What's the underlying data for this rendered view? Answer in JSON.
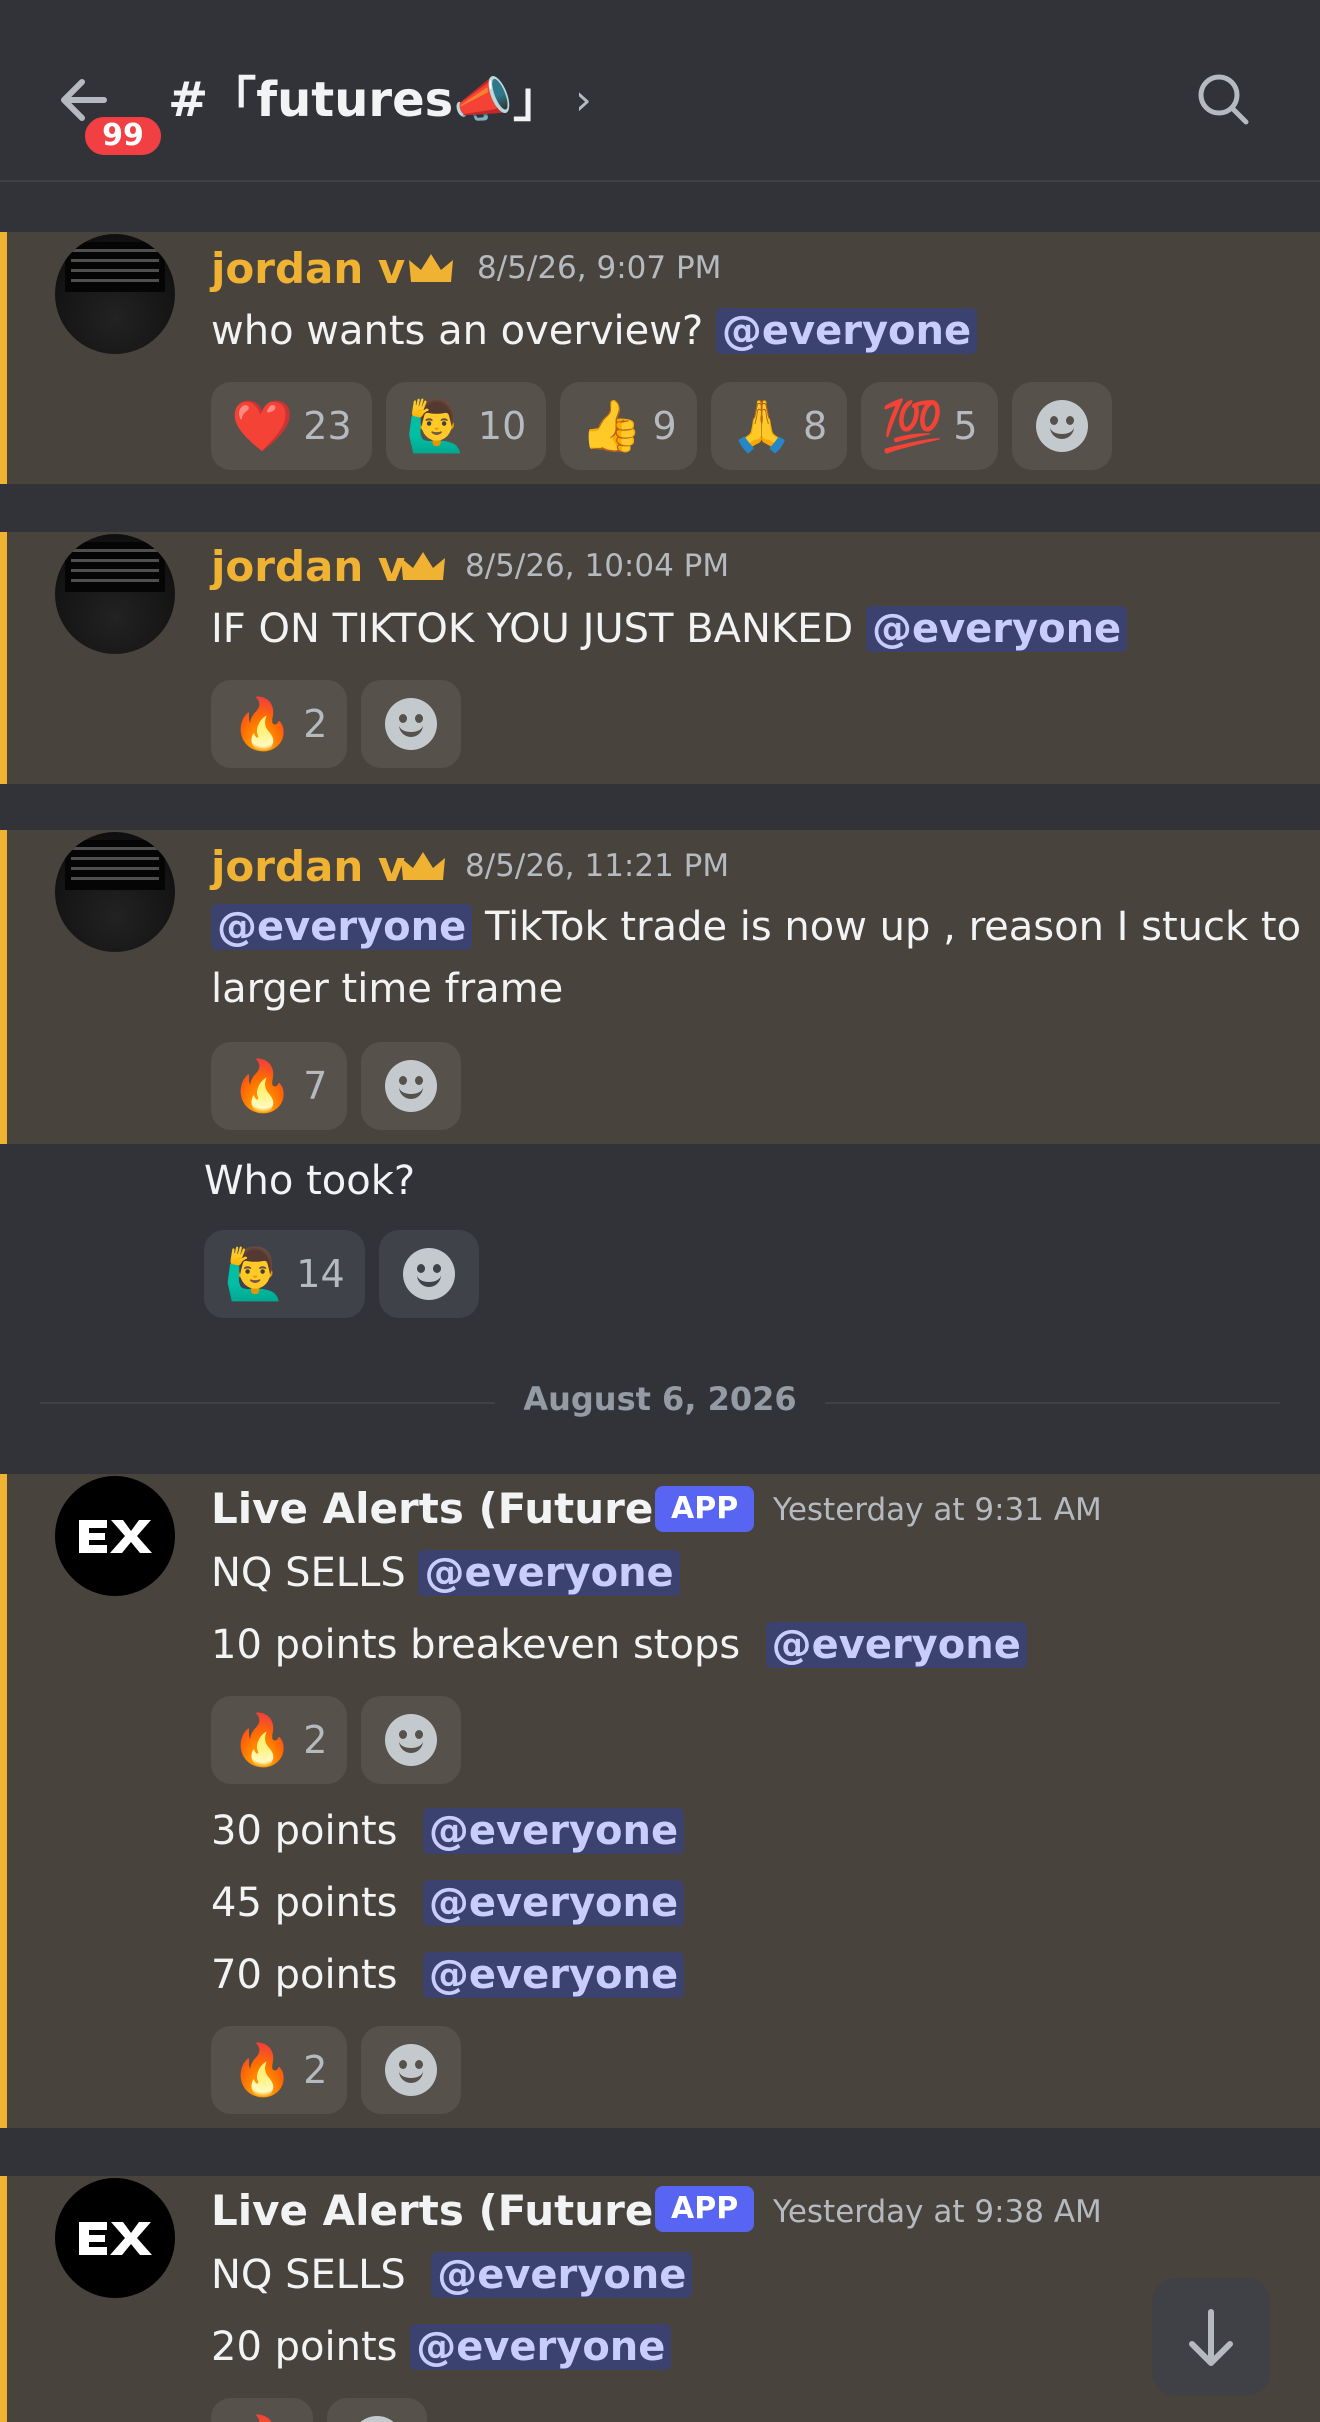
{
  "header": {
    "back_label": "Back",
    "badge_count": "99",
    "channel_title": "#「futures📣」",
    "chevron": "›",
    "search_icon": "search-icon"
  },
  "messages": [
    {
      "author": "jordan v",
      "timestamp": "8/5/26, 9:07 PM",
      "text": "who wants an overview?",
      "mention": "@everyone",
      "reactions": [
        {
          "emoji": "❤️",
          "count": "23"
        },
        {
          "emoji": "🙋‍♂️",
          "count": "10"
        },
        {
          "emoji": "👍",
          "count": "9"
        },
        {
          "emoji": "🙏",
          "count": "8"
        },
        {
          "emoji": "💯",
          "count": "5"
        }
      ]
    },
    {
      "author": "jordan v",
      "timestamp": "8/5/26, 10:04 PM",
      "text": "IF ON TIKTOK YOU JUST BANKED",
      "mention": "@everyone",
      "reactions": [
        {
          "emoji": "🔥",
          "count": "2"
        }
      ]
    },
    {
      "author": "jordan v",
      "timestamp": "8/5/26, 11:21 PM",
      "mention": "@everyone",
      "text_line1": "TikTok trade is now up , reason I stuck to",
      "text_line2": "larger time frame",
      "reactions": [
        {
          "emoji": "🔥",
          "count": "7"
        }
      ]
    },
    {
      "text": "Who took?",
      "reactions": [
        {
          "emoji": "🙋‍♂️",
          "count": "14"
        }
      ]
    },
    {
      "author": "Live Alerts (Futures)",
      "app_badge": "APP",
      "timestamp": "Yesterday at 9:31 AM",
      "line1": "NQ SELLS",
      "line1_mention": "@everyone",
      "line2": "10 points breakeven stops",
      "line2_mention": "@everyone",
      "reactions1": [
        {
          "emoji": "🔥",
          "count": "2"
        }
      ],
      "line3": "30 points",
      "line3_mention": "@everyone",
      "line4": "45 points",
      "line4_mention": "@everyone",
      "line5": "70 points",
      "line5_mention": "@everyone",
      "reactions2": [
        {
          "emoji": "🔥",
          "count": "2"
        }
      ]
    },
    {
      "author": "Live Alerts (Futures)",
      "app_badge": "APP",
      "timestamp": "Yesterday at 9:38 AM",
      "line1": "NQ SELLS",
      "line1_mention": "@everyone",
      "line2": "20 points",
      "line2_mention": "@everyone"
    }
  ],
  "date_divider": "August 6, 2026",
  "colors": {
    "background": "#313338",
    "highlight": "#48433c",
    "highlight_bar": "#f0b232",
    "mention_bg": "#3c4270",
    "app_badge": "#5865f2",
    "unread_badge": "#f23f43"
  }
}
